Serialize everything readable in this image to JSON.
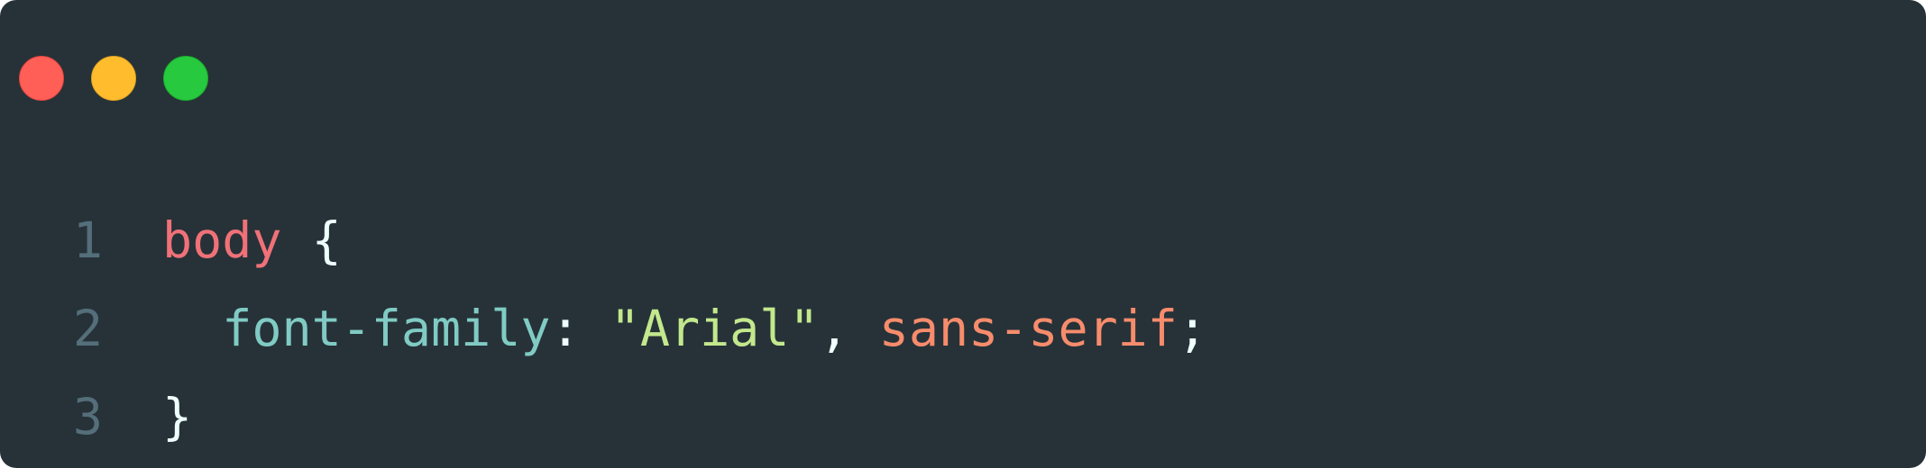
{
  "window": {
    "background": "#263238",
    "controls": [
      {
        "name": "close",
        "color": "#ff5f56",
        "border": "#e0443e"
      },
      {
        "name": "minimize",
        "color": "#ffbd2e",
        "border": "#dea123"
      },
      {
        "name": "maximize",
        "color": "#27c93f",
        "border": "#1aab29"
      }
    ]
  },
  "code": {
    "lines": [
      {
        "number": "1",
        "tokens": [
          {
            "text": "body",
            "color": "#f07178"
          },
          {
            "text": " ",
            "color": "#eeffff"
          },
          {
            "text": "{",
            "color": "#eeffff"
          }
        ]
      },
      {
        "number": "2",
        "tokens": [
          {
            "text": "  ",
            "color": "#eeffff"
          },
          {
            "text": "font-family",
            "color": "#80cbc4"
          },
          {
            "text": ":",
            "color": "#eeffff"
          },
          {
            "text": " ",
            "color": "#eeffff"
          },
          {
            "text": "\"Arial\"",
            "color": "#c3e88d"
          },
          {
            "text": ",",
            "color": "#eeffff"
          },
          {
            "text": " ",
            "color": "#eeffff"
          },
          {
            "text": "sans-serif",
            "color": "#f78c6c"
          },
          {
            "text": ";",
            "color": "#eeffff"
          }
        ]
      },
      {
        "number": "3",
        "tokens": [
          {
            "text": "}",
            "color": "#eeffff"
          }
        ]
      }
    ]
  }
}
